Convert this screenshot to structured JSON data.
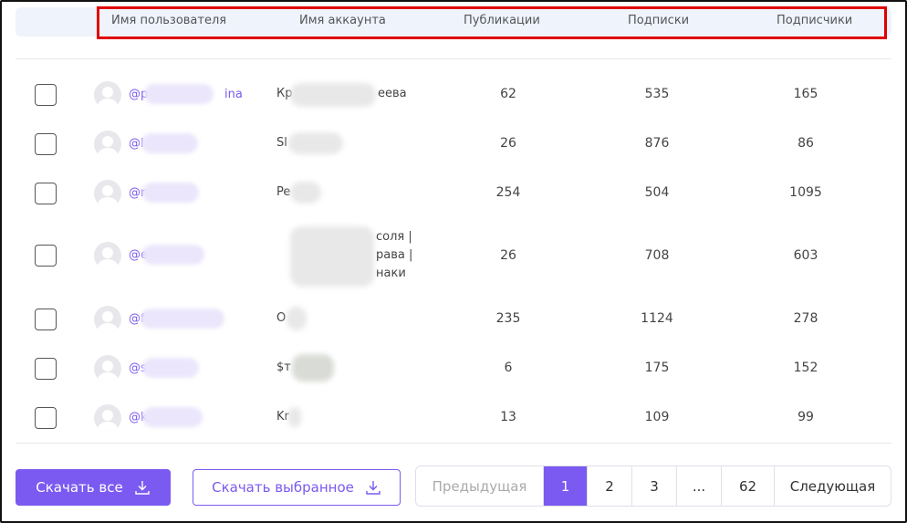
{
  "table": {
    "headers": {
      "username": "Имя пользователя",
      "account": "Имя аккаунта",
      "publications": "Публикации",
      "subscriptions": "Подписки",
      "followers": "Подписчики"
    },
    "rows": [
      {
        "username_prefix": "@p",
        "username_suffix": "ina",
        "account_prefix": "Кр",
        "account_suffix": "еева",
        "publications": "62",
        "subscriptions": "535",
        "followers": "165"
      },
      {
        "username_prefix": "@l",
        "username_suffix": "",
        "account_prefix": "Sl",
        "account_suffix": "",
        "publications": "26",
        "subscriptions": "876",
        "followers": "86"
      },
      {
        "username_prefix": "@r",
        "username_suffix": "",
        "account_prefix": "Pe",
        "account_suffix": "",
        "publications": "254",
        "subscriptions": "504",
        "followers": "1095"
      },
      {
        "username_prefix": "@e",
        "username_suffix": "",
        "account_line1": "соля |",
        "account_line2": "рава |",
        "account_line3": "наки",
        "publications": "26",
        "subscriptions": "708",
        "followers": "603"
      },
      {
        "username_prefix": "@f",
        "username_suffix": "",
        "account_prefix": "O",
        "account_suffix": "",
        "publications": "235",
        "subscriptions": "1124",
        "followers": "278"
      },
      {
        "username_prefix": "@s",
        "username_suffix": "",
        "account_prefix": "$т",
        "account_suffix": "",
        "publications": "6",
        "subscriptions": "175",
        "followers": "152"
      },
      {
        "username_prefix": "@k",
        "username_suffix": "",
        "account_prefix": "Kr",
        "account_suffix": "",
        "publications": "13",
        "subscriptions": "109",
        "followers": "99"
      }
    ]
  },
  "actions": {
    "download_all": "Скачать все",
    "download_selected": "Скачать выбранное"
  },
  "pagination": {
    "prev": "Предыдущая",
    "pages": [
      "1",
      "2",
      "3",
      "...",
      "62"
    ],
    "next": "Следующая"
  },
  "colors": {
    "accent": "#7a5af0",
    "highlight": "#e00000"
  }
}
